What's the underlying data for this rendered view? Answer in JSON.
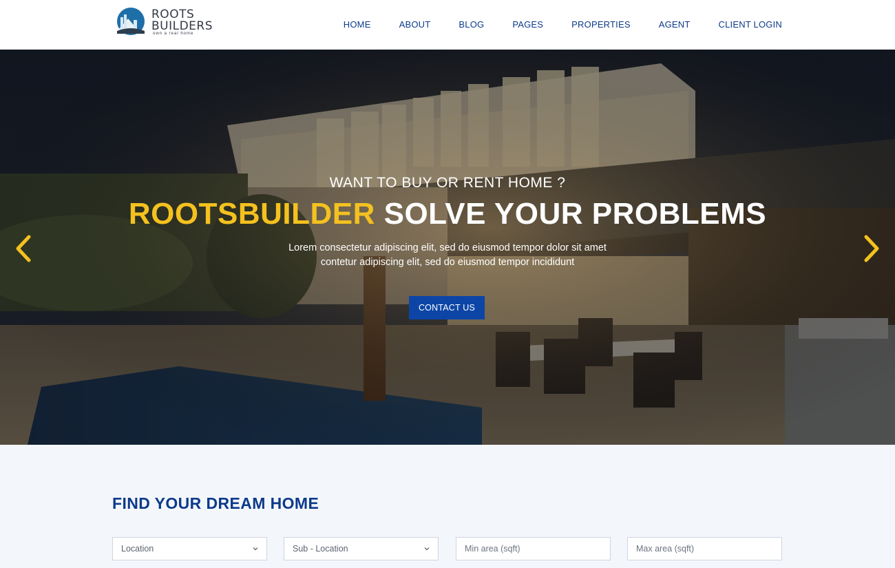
{
  "brand": {
    "line1": "ROOTS",
    "line2": "BUILDERS",
    "tagline": "own a real home"
  },
  "nav": {
    "items": [
      "HOME",
      "ABOUT",
      "BLOG",
      "PAGES",
      "PROPERTIES",
      "AGENT",
      "CLIENT LOGIN"
    ]
  },
  "hero": {
    "subtitle": "WANT TO BUY OR RENT HOME ?",
    "title_highlight": "ROOTSBUILDER",
    "title_rest": "SOLVE YOUR PROBLEMS",
    "desc_line1": "Lorem consectetur adipiscing elit, sed do eiusmod tempor dolor sit amet",
    "desc_line2": "contetur adipiscing elit, sed do eiusmod tempor incididunt",
    "cta_label": "CONTACT US"
  },
  "search": {
    "title": "FIND YOUR DREAM HOME",
    "location": "Location",
    "sub_location": "Sub - Location",
    "min_area_placeholder": "Min area (sqft)",
    "max_area_placeholder": "Max area (sqft)"
  },
  "colors": {
    "brand_blue": "#0c3a8a",
    "button_blue": "#0c45a6",
    "accent_yellow": "#f4c11f"
  },
  "icons": {
    "prev": "chevron-left-icon",
    "next": "chevron-right-icon",
    "dropdown": "chevron-down-icon"
  }
}
